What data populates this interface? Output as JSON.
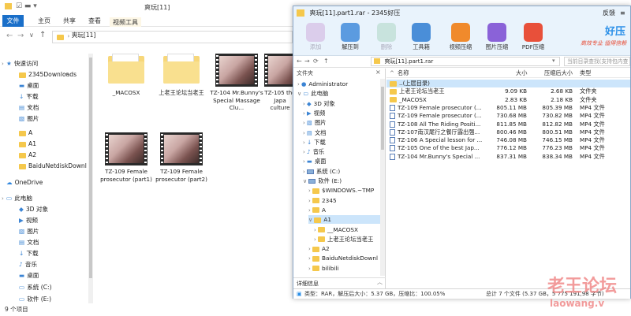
{
  "explorer": {
    "title": "爽玩[11]",
    "ribbon_tabs": [
      "文件",
      "主页",
      "共享",
      "查看",
      "视频工具"
    ],
    "play_tab": "播放",
    "address": "爽玩[11]",
    "nav_items": [
      {
        "label": "快速访问",
        "icon": "star-icon",
        "pin": false
      },
      {
        "label": "2345Downloads",
        "icon": "folder-icon",
        "pin": true
      },
      {
        "label": "桌面",
        "icon": "desktop-icon",
        "pin": true
      },
      {
        "label": "下载",
        "icon": "download-icon",
        "pin": true
      },
      {
        "label": "文档",
        "icon": "documents-icon",
        "pin": true
      },
      {
        "label": "图片",
        "icon": "pictures-icon",
        "pin": true
      },
      {
        "label": "A",
        "icon": "folder-icon",
        "pin": false
      },
      {
        "label": "A1",
        "icon": "folder-icon",
        "pin": false
      },
      {
        "label": "A2",
        "icon": "folder-icon",
        "pin": false
      },
      {
        "label": "BaiduNetdiskDownl",
        "icon": "folder-icon",
        "pin": false
      },
      {
        "label": "OneDrive",
        "icon": "cloud-icon",
        "pin": false
      },
      {
        "label": "此电脑",
        "icon": "computer-icon",
        "pin": false
      },
      {
        "label": "3D 对象",
        "icon": "3d-objects-icon",
        "pin": false
      },
      {
        "label": "视频",
        "icon": "videos-icon",
        "pin": false
      },
      {
        "label": "图片",
        "icon": "pictures-icon",
        "pin": false
      },
      {
        "label": "文档",
        "icon": "documents-icon",
        "pin": false
      },
      {
        "label": "下载",
        "icon": "download-icon",
        "pin": false
      },
      {
        "label": "音乐",
        "icon": "music-icon",
        "pin": false
      },
      {
        "label": "桌面",
        "icon": "desktop-icon",
        "pin": false
      },
      {
        "label": "系统 (C:)",
        "icon": "drive-icon",
        "pin": false
      },
      {
        "label": "软件 (E:)",
        "icon": "drive-icon",
        "pin": false
      }
    ],
    "files": [
      {
        "name": "_MACOSX",
        "type": "folder"
      },
      {
        "name": "上老王论坛当老王",
        "type": "folder"
      },
      {
        "name": "TZ-104 Mr.Bunny's Special Massage Clu...",
        "type": "video"
      },
      {
        "name": "TZ-105 the Japa culture",
        "type": "video"
      },
      {
        "name": "TZ-109 Female prosecutor (part1)",
        "type": "video"
      },
      {
        "name": "TZ-109 Female prosecutor (part2)",
        "type": "video"
      }
    ],
    "status": "9 个项目"
  },
  "zip": {
    "title": "爽玩[11].part1.rar - 2345好压",
    "login": "反馈",
    "toolbar": [
      {
        "label": "添加",
        "icon": "add-icon",
        "disabled": true,
        "color": "#c9a0d8"
      },
      {
        "label": "解压到",
        "icon": "extract-icon",
        "disabled": false,
        "color": "#5b9be0"
      },
      {
        "label": "删除",
        "icon": "delete-icon",
        "disabled": true,
        "color": "#9fd1b8"
      },
      {
        "label": "工具箱",
        "icon": "toolbox-icon",
        "disabled": false,
        "color": "#4a8ed8"
      },
      {
        "label": "视频压缩",
        "icon": "video-compress-icon",
        "disabled": false,
        "color": "#f08a2c"
      },
      {
        "label": "图片压缩",
        "icon": "image-compress-icon",
        "disabled": false,
        "color": "#8a62d8"
      },
      {
        "label": "PDF压缩",
        "icon": "pdf-compress-icon",
        "disabled": false,
        "color": "#e8503a"
      }
    ],
    "brand": "好压",
    "brand_slogan": "高效专业 值得信赖",
    "address": "爽玩[11].part1.rar",
    "search_placeholder": "当前目录查找(支持包内查",
    "folder_pane_title": "文件夹",
    "tree": [
      {
        "label": "Administrator",
        "indent": 1,
        "icon": "user-icon"
      },
      {
        "label": "此电脑",
        "indent": 1,
        "icon": "computer-icon"
      },
      {
        "label": "3D 对象",
        "indent": 2,
        "icon": "3d-objects-icon"
      },
      {
        "label": "视频",
        "indent": 2,
        "icon": "videos-icon"
      },
      {
        "label": "图片",
        "indent": 2,
        "icon": "pictures-icon"
      },
      {
        "label": "文档",
        "indent": 2,
        "icon": "documents-icon"
      },
      {
        "label": "下载",
        "indent": 2,
        "icon": "download-icon"
      },
      {
        "label": "音乐",
        "indent": 2,
        "icon": "music-icon"
      },
      {
        "label": "桌面",
        "indent": 2,
        "icon": "desktop-icon"
      },
      {
        "label": "系统 (C:)",
        "indent": 2,
        "icon": "drive-icon"
      },
      {
        "label": "软件 (E:)",
        "indent": 2,
        "icon": "drive-icon"
      },
      {
        "label": "$WINDOWS.~TMP",
        "indent": 3,
        "icon": "folder-icon"
      },
      {
        "label": "2345",
        "indent": 3,
        "icon": "folder-icon"
      },
      {
        "label": "A",
        "indent": 3,
        "icon": "folder-icon"
      },
      {
        "label": "A1",
        "indent": 3,
        "icon": "folder-icon",
        "selected": true
      },
      {
        "label": "__MACOSX",
        "indent": 4,
        "icon": "folder-icon"
      },
      {
        "label": "上老王论坛当老王",
        "indent": 4,
        "icon": "folder-icon"
      },
      {
        "label": "A2",
        "indent": 3,
        "icon": "folder-icon"
      },
      {
        "label": "BaiduNetdiskDownl",
        "indent": 3,
        "icon": "folder-icon"
      },
      {
        "label": "bilibili",
        "indent": 3,
        "icon": "folder-icon"
      }
    ],
    "detail_label": "详细信息",
    "columns": [
      "名称",
      "大小",
      "压缩后大小",
      "类型"
    ],
    "rows": [
      {
        "name": "..(上层目录)",
        "size": "",
        "packed": "",
        "type": "",
        "icon": "folder-icon"
      },
      {
        "name": "上老王论坛当老王",
        "size": "9.09 KB",
        "packed": "2.68 KB",
        "type": "文件夹",
        "icon": "folder-icon"
      },
      {
        "name": "_MACOSX",
        "size": "2.83 KB",
        "packed": "2.18 KB",
        "type": "文件夹",
        "icon": "folder-icon"
      },
      {
        "name": "TZ-109 Female prosecutor (...",
        "size": "805.11 MB",
        "packed": "805.39 MB",
        "type": "MP4 文件",
        "icon": "file-icon"
      },
      {
        "name": "TZ-109 Female prosecutor (...",
        "size": "730.68 MB",
        "packed": "730.82 MB",
        "type": "MP4 文件",
        "icon": "file-icon"
      },
      {
        "name": "TZ-108 All The Riding Positi...",
        "size": "811.85 MB",
        "packed": "812.82 MB",
        "type": "MP4 文件",
        "icon": "file-icon"
      },
      {
        "name": "TZ-107南汉尾行之餐厅露出强...",
        "size": "800.46 MB",
        "packed": "800.51 MB",
        "type": "MP4 文件",
        "icon": "file-icon"
      },
      {
        "name": "TZ-106 A Special lesson for ...",
        "size": "746.08 MB",
        "packed": "746.15 MB",
        "type": "MP4 文件",
        "icon": "file-icon"
      },
      {
        "name": "TZ-105 One of the best Jap...",
        "size": "776.12 MB",
        "packed": "776.23 MB",
        "type": "MP4 文件",
        "icon": "file-icon"
      },
      {
        "name": "TZ-104 Mr.Bunny's Special ...",
        "size": "837.31 MB",
        "packed": "838.34 MB",
        "type": "MP4 文件",
        "icon": "file-icon"
      }
    ],
    "status_left": "类型：RAR，解压后大小：5.37 GB，压缩比：100.05%",
    "status_right": "总计 7 个文件 (5.37 GB，5 775 191,98 字节)"
  },
  "watermark": {
    "big": "老王论坛",
    "small": "laowang.v"
  }
}
